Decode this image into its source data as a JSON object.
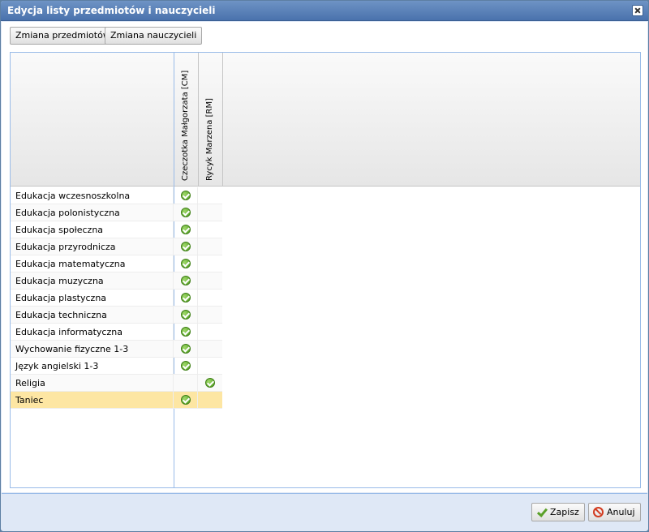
{
  "window": {
    "title": "Edycja listy przedmiotów i nauczycieli"
  },
  "toolbar": {
    "change_subjects": "Zmiana przedmiotów",
    "change_teachers": "Zmiana nauczycieli"
  },
  "teachers": [
    "Czeczotka Małgorzata [CM]",
    "Rycyk Marzena [RM]"
  ],
  "subjects": [
    {
      "name": "Edukacja wczesnoszkolna",
      "cm": true,
      "rm": false
    },
    {
      "name": "Edukacja polonistyczna",
      "cm": true,
      "rm": false
    },
    {
      "name": "Edukacja społeczna",
      "cm": true,
      "rm": false
    },
    {
      "name": "Edukacja przyrodnicza",
      "cm": true,
      "rm": false
    },
    {
      "name": "Edukacja matematyczna",
      "cm": true,
      "rm": false
    },
    {
      "name": "Edukacja muzyczna",
      "cm": true,
      "rm": false
    },
    {
      "name": "Edukacja plastyczna",
      "cm": true,
      "rm": false
    },
    {
      "name": "Edukacja techniczna",
      "cm": true,
      "rm": false
    },
    {
      "name": "Edukacja informatyczna",
      "cm": true,
      "rm": false
    },
    {
      "name": "Wychowanie fizyczne 1-3",
      "cm": true,
      "rm": false
    },
    {
      "name": "Język angielski 1-3",
      "cm": true,
      "rm": false
    },
    {
      "name": "Religia",
      "cm": false,
      "rm": true
    },
    {
      "name": "Taniec",
      "cm": true,
      "rm": false,
      "selected": true
    }
  ],
  "icons": {
    "check": "check-circle-icon",
    "close": "close-icon",
    "save": "checkmark-icon",
    "cancel": "cancel-icon"
  },
  "footer": {
    "save": "Zapisz",
    "cancel": "Anuluj"
  }
}
